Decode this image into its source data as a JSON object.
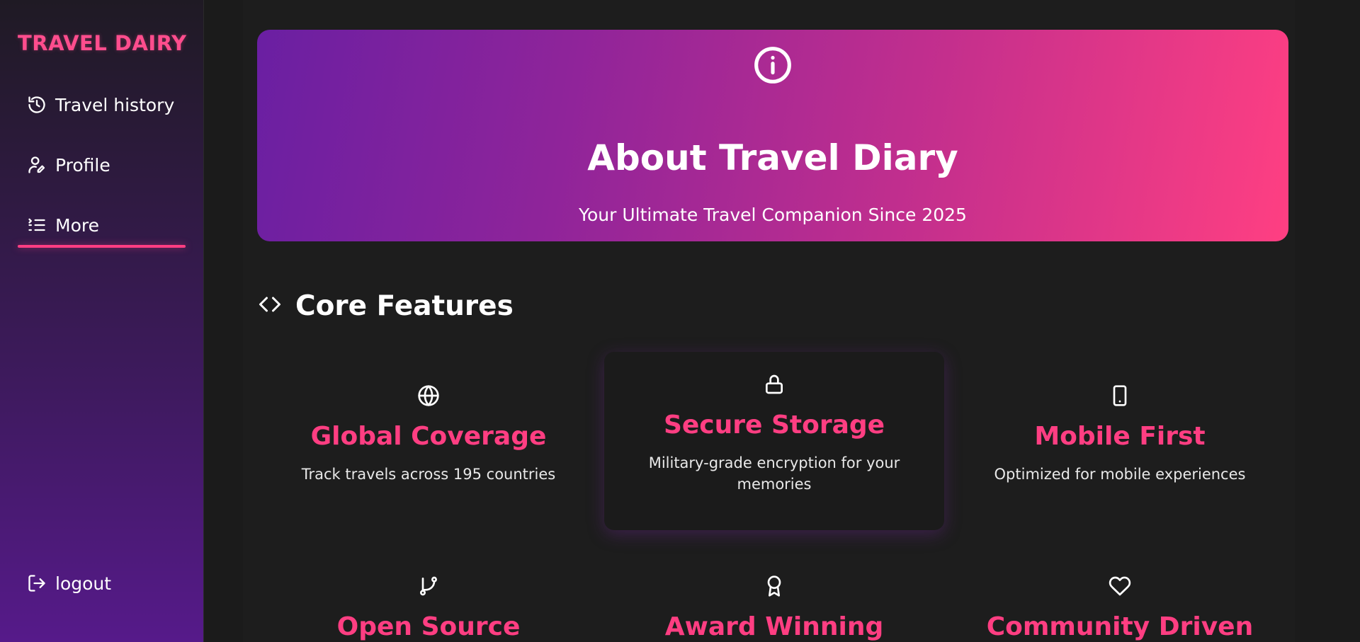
{
  "sidebar": {
    "brand": "TRAVEL DAIRY",
    "items": [
      {
        "label": "Travel history",
        "icon": "history-icon"
      },
      {
        "label": "Profile",
        "icon": "user-edit-icon"
      },
      {
        "label": "More",
        "icon": "list-icon",
        "active": true
      }
    ],
    "logout": {
      "label": "logout",
      "icon": "logout-icon"
    }
  },
  "hero": {
    "icon": "info-icon",
    "title": "About Travel Diary",
    "subtitle": "Your Ultimate Travel Companion Since 2025"
  },
  "features": {
    "icon": "code-icon",
    "title": "Core Features",
    "cards": [
      {
        "icon": "globe-icon",
        "title": "Global Coverage",
        "desc": "Track travels across 195 countries"
      },
      {
        "icon": "lock-icon",
        "title": "Secure Storage",
        "desc": "Military-grade encryption for your memories"
      },
      {
        "icon": "mobile-icon",
        "title": "Mobile First",
        "desc": "Optimized for mobile experiences"
      },
      {
        "icon": "git-branch-icon",
        "title": "Open Source",
        "desc": ""
      },
      {
        "icon": "award-icon",
        "title": "Award Winning",
        "desc": ""
      },
      {
        "icon": "heart-icon",
        "title": "Community Driven",
        "desc": ""
      }
    ]
  },
  "colors": {
    "accent": "#ff3e82",
    "background": "#1b1b1b",
    "hero_gradient_start": "#6a1fa2",
    "hero_gradient_end": "#ff3f82"
  }
}
